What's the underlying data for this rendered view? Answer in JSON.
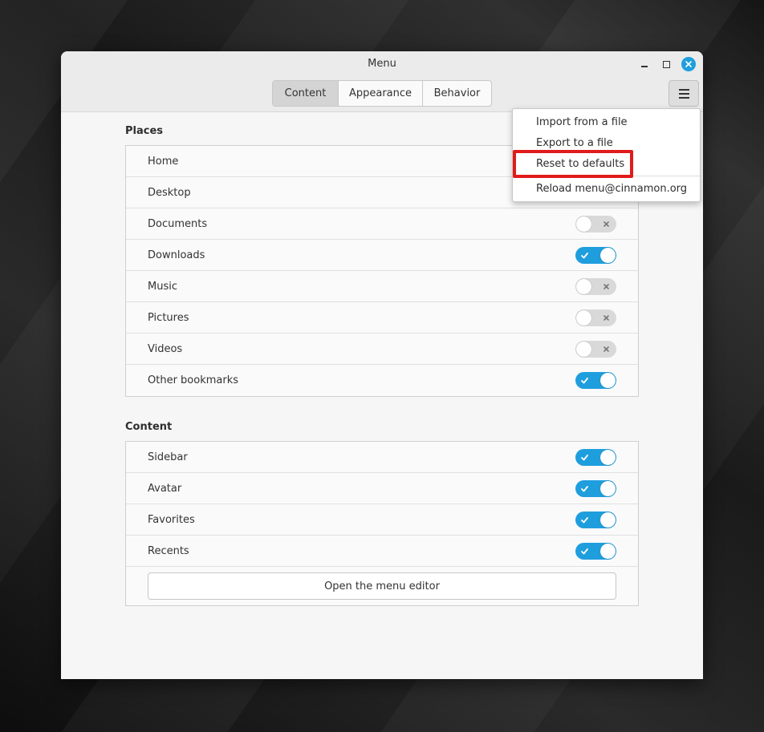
{
  "window": {
    "title": "Menu"
  },
  "tabs": [
    {
      "label": "Content",
      "active": true
    },
    {
      "label": "Appearance",
      "active": false
    },
    {
      "label": "Behavior",
      "active": false
    }
  ],
  "places": {
    "title": "Places",
    "items": [
      {
        "label": "Home"
      },
      {
        "label": "Desktop"
      },
      {
        "label": "Documents",
        "enabled": false
      },
      {
        "label": "Downloads",
        "enabled": true
      },
      {
        "label": "Music",
        "enabled": false
      },
      {
        "label": "Pictures",
        "enabled": false
      },
      {
        "label": "Videos",
        "enabled": false
      },
      {
        "label": "Other bookmarks",
        "enabled": true
      }
    ]
  },
  "content": {
    "title": "Content",
    "items": [
      {
        "label": "Sidebar",
        "enabled": true
      },
      {
        "label": "Avatar",
        "enabled": true
      },
      {
        "label": "Favorites",
        "enabled": true
      },
      {
        "label": "Recents",
        "enabled": true
      }
    ],
    "editor_button": "Open the menu editor"
  },
  "menu_popup": {
    "items": [
      {
        "label": "Import from a file"
      },
      {
        "label": "Export to a file"
      },
      {
        "label": "Reset to defaults"
      },
      {
        "label": "Reload menu@cinnamon.org"
      }
    ]
  },
  "colors": {
    "accent": "#1f9ede",
    "highlight": "#e01b1b",
    "switch_off": "#d9d9d9"
  },
  "icons": {
    "close": "close-icon",
    "minimize": "minimize-icon",
    "maximize": "maximize-icon",
    "menu": "hamburger-menu-icon",
    "check": "check-icon",
    "cross": "x-icon"
  }
}
